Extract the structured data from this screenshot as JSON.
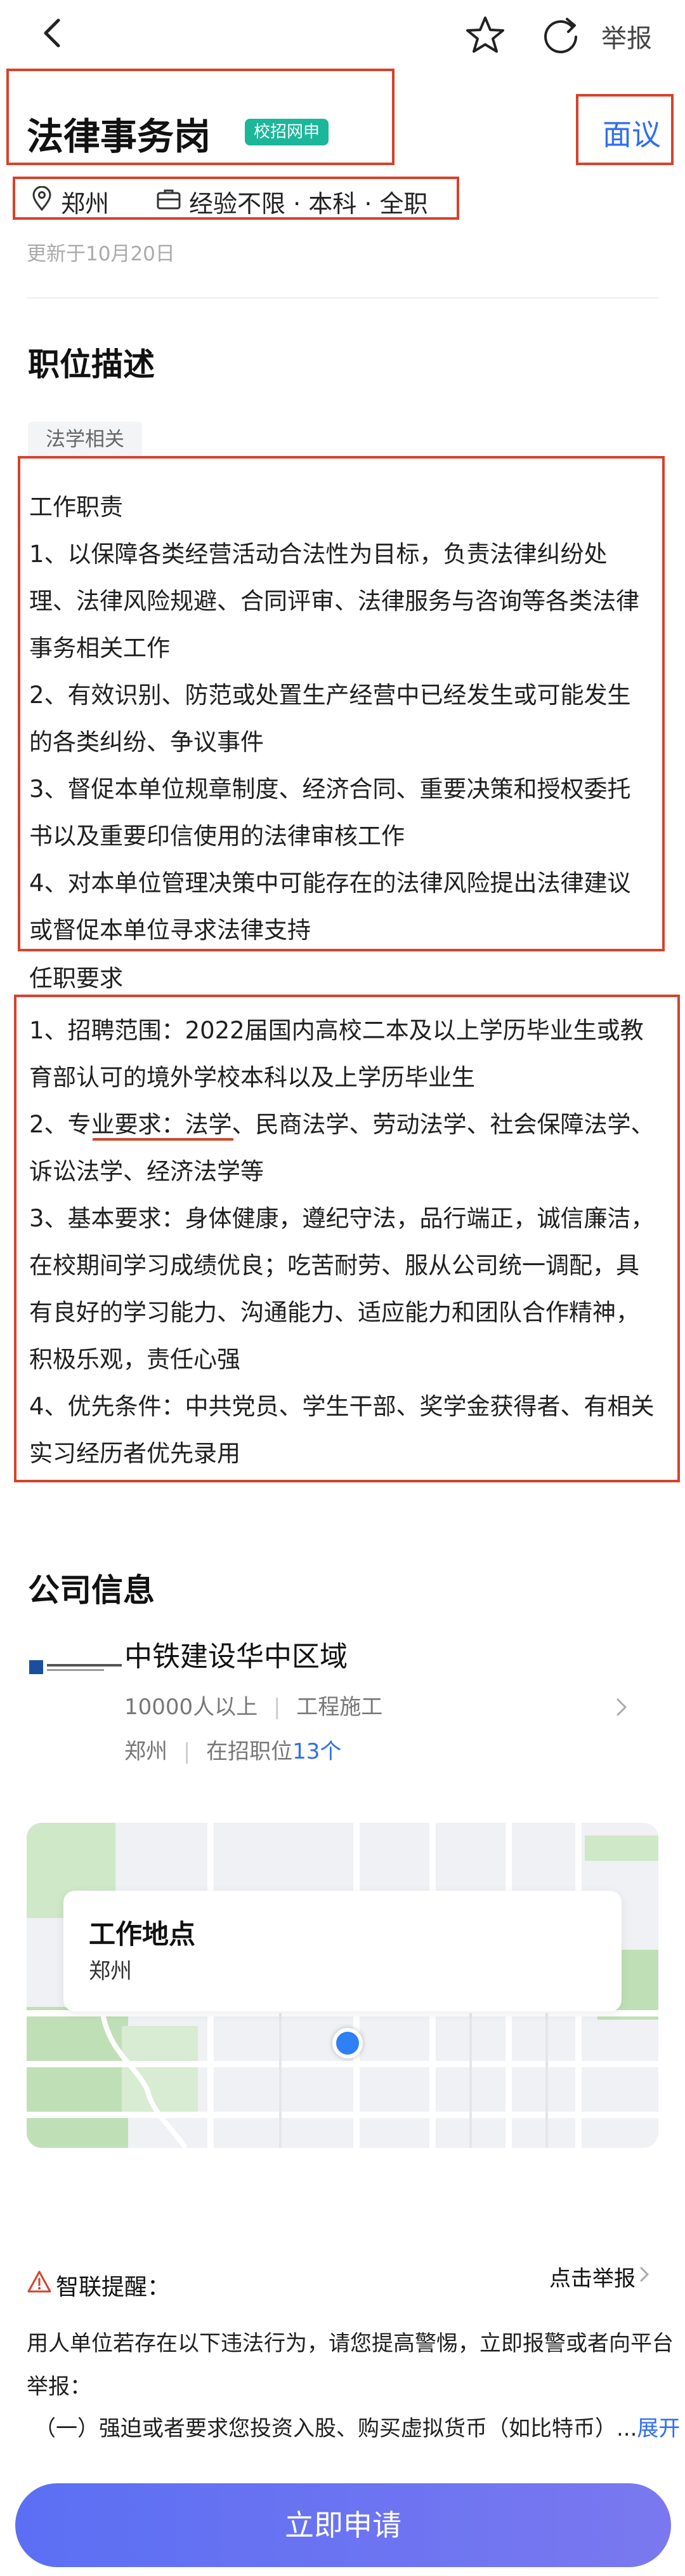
{
  "topbar": {
    "report": "举报"
  },
  "job": {
    "title": "法律事务岗",
    "badge": "校招网申",
    "salary": "面议",
    "city": "郑州",
    "requirements": "经验不限 · 本科 · 全职",
    "updated": "更新于10月20日"
  },
  "description": {
    "heading": "职位描述",
    "tag": "法学相关",
    "duties_lines": [
      "工作职责",
      "1、以保障各类经营活动合法性为目标，负责法律纠纷处",
      "理、法律风险规避、合同评审、法律服务与咨询等各类法律",
      "事务相关工作",
      "2、有效识别、防范或处置生产经营中已经发生或可能发生",
      "的各类纠纷、争议事件",
      "3、督促本单位规章制度、经济合同、重要决策和授权委托",
      "书以及重要印信使用的法律审核工作",
      "4、对本单位管理决策中可能存在的法律风险提出法律建议",
      "或督促本单位寻求法律支持"
    ],
    "requirements_lines": [
      "任职要求",
      "1、招聘范围：2022届国内高校二本及以上学历毕业生或教",
      "育部认可的境外学校本科以及上学历毕业生",
      "2、专业要求：法学、民商法学、劳动法学、社会保障法学、",
      "诉讼法学、经济法学等",
      "3、基本要求：身体健康，遵纪守法，品行端正，诚信廉洁，",
      "在校期间学习成绩优良；吃苦耐劳、服从公司统一调配，具",
      "有良好的学习能力、沟通能力、适应能力和团队合作精神，",
      "积极乐观，责任心强",
      "4、优先条件：中共党员、学生干部、奖学金获得者、有相关",
      "实习经历者优先录用"
    ]
  },
  "company": {
    "heading": "公司信息",
    "name": "中铁建设华中区域",
    "size": "10000人以上",
    "industry": "工程施工",
    "city": "郑州",
    "positions_label": "在招职位",
    "positions_count": "13个"
  },
  "map": {
    "title": "工作地点",
    "city": "郑州"
  },
  "notice": {
    "title": "智联提醒：",
    "report_link": "点击举报",
    "line1": "用人单位若存在以下违法行为，请您提高警惕，立即报警或者向平台",
    "line2": "举报：",
    "line3": "（一）强迫或者要求您投资入股、购买虚拟货币（如比特币）...",
    "expand": "展开"
  },
  "apply": {
    "label": "立即申请"
  },
  "colors": {
    "accent": "#2f6ef1",
    "badge": "#1bb79a",
    "annotation": "#d6422c",
    "button": "#6b74f2"
  }
}
